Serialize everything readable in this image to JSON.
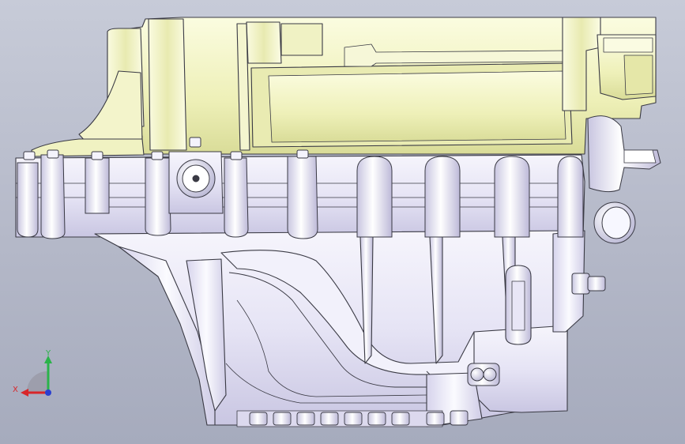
{
  "viewport": {
    "background_top": "#c7cbd8",
    "background_bottom": "#a6abbd"
  },
  "model": {
    "upper_color": "#f3f5c6",
    "lower_color": "#eceaf8",
    "edge_color": "#3a3a44"
  },
  "triad": {
    "x_label": "X",
    "y_label": "Y",
    "x_color": "#d8262a",
    "y_color": "#2bb34a",
    "z_color": "#2a3fd0"
  }
}
